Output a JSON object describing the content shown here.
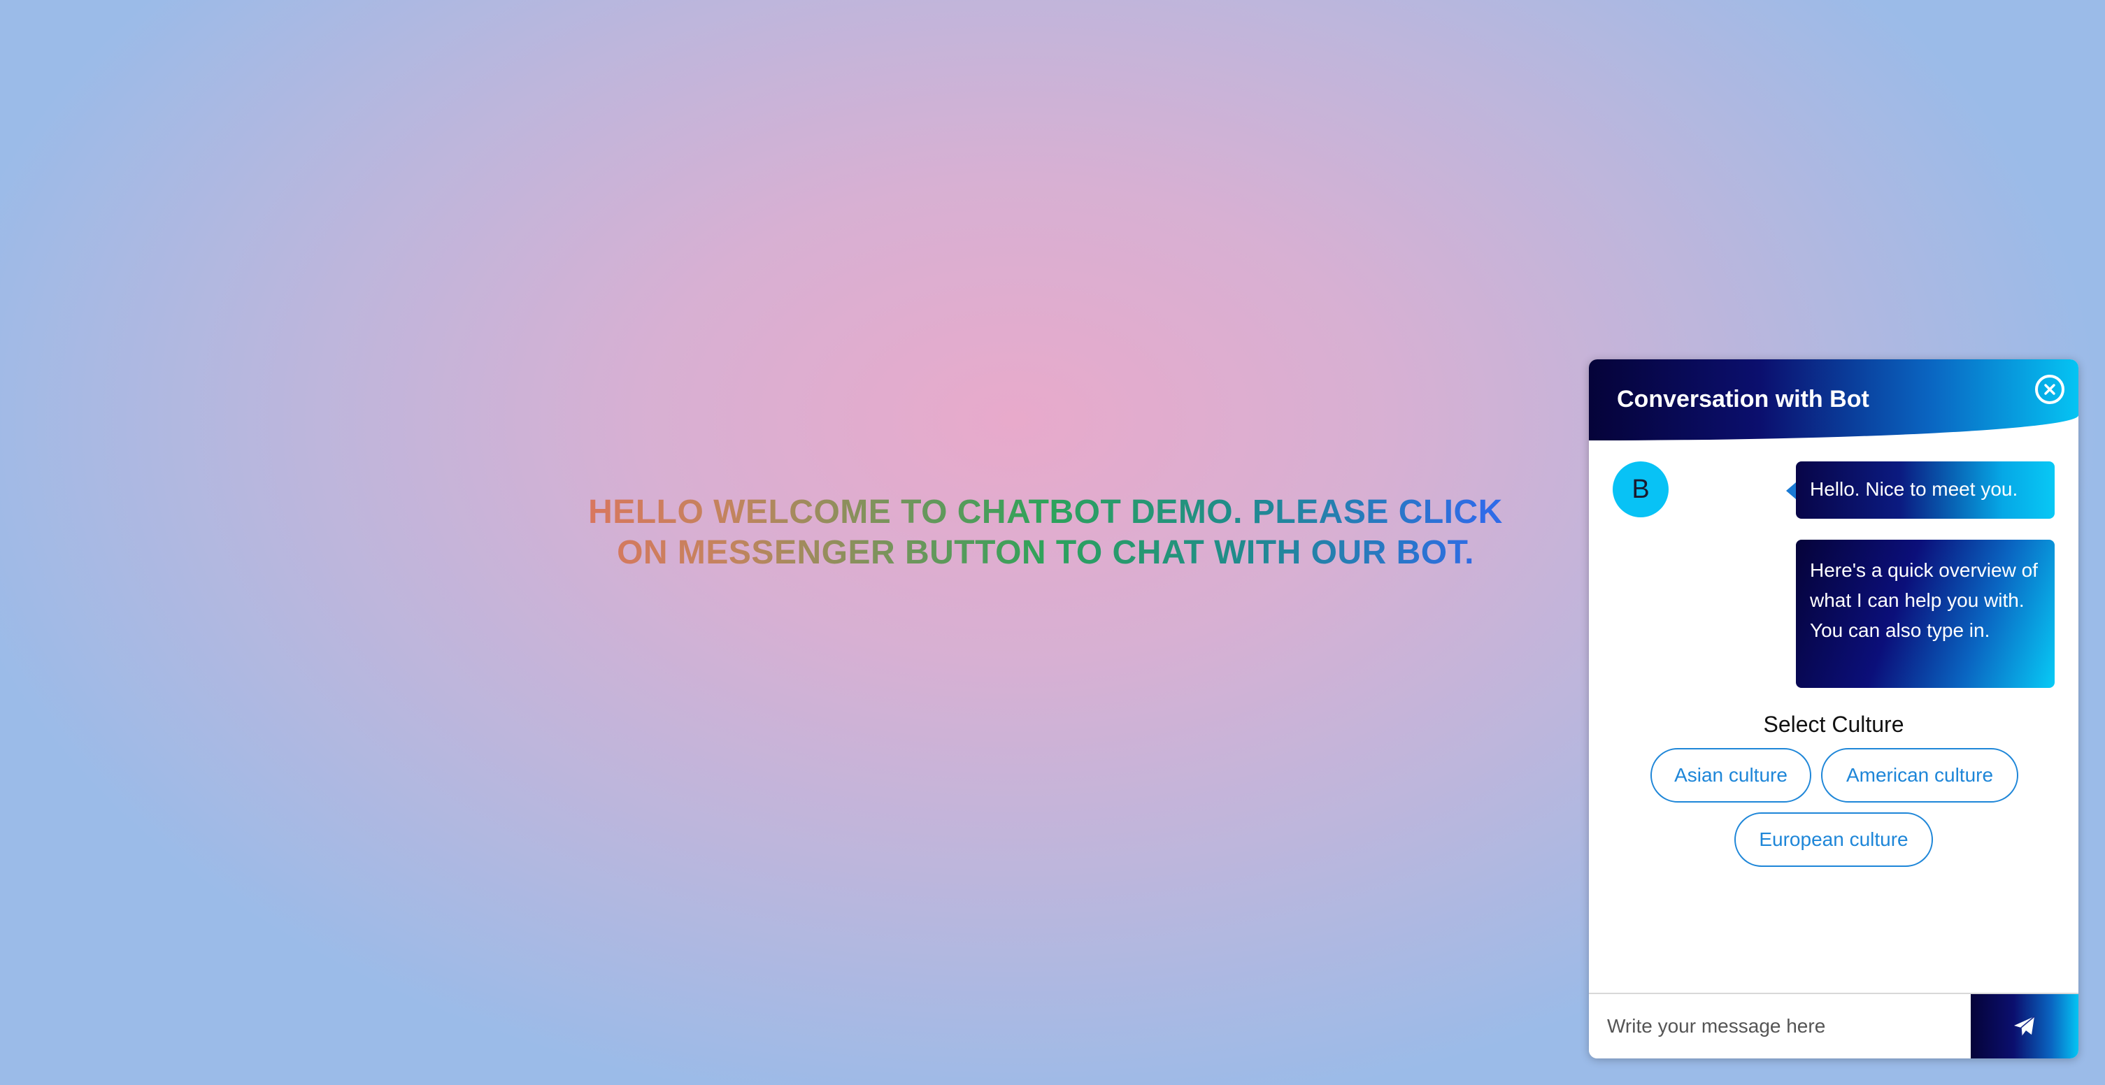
{
  "hero": {
    "line1": "HELLO WELCOME TO CHATBOT DEMO. PLEASE CLICK",
    "line2": "ON MESSENGER BUTTON TO CHAT WITH OUR BOT."
  },
  "chat": {
    "title": "Conversation with Bot",
    "close_icon": "close-circle-icon",
    "bot_avatar_letter": "B",
    "messages": [
      "Hello. Nice to meet you.",
      "Here's a quick overview of what I can help you with. You can also type in."
    ],
    "select_label": "Select Culture",
    "options": [
      "Asian culture",
      "American culture",
      "European culture"
    ],
    "input_placeholder": "Write your message here",
    "send_icon": "paper-plane-icon"
  },
  "colors": {
    "accent_blue": "#1e86d8",
    "header_dark": "#050339",
    "header_cyan": "#05c4f3",
    "avatar_cyan": "#08c2f5"
  }
}
